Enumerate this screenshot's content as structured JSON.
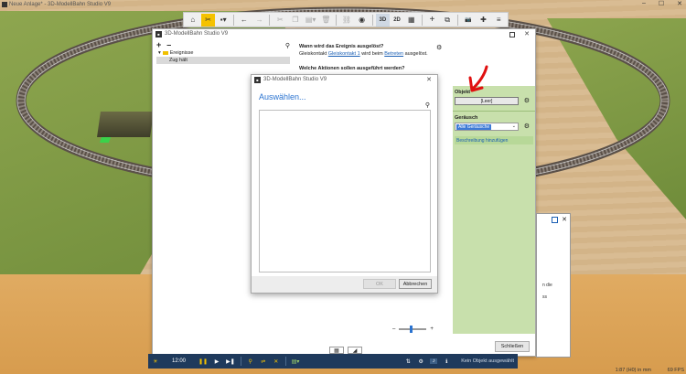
{
  "app": {
    "title": "Neue Anlage* - 3D-ModellBahn Studio V9",
    "window_controls": [
      "–",
      "☐",
      "✕"
    ]
  },
  "toolbar": {
    "buttons": [
      {
        "name": "home-icon",
        "glyph": "⌂",
        "state": "normal"
      },
      {
        "name": "tools-icon",
        "glyph": "✂",
        "state": "active"
      },
      {
        "name": "save-icon",
        "glyph": "▪▾",
        "state": "normal"
      },
      {
        "name": "undo-icon",
        "glyph": "←",
        "state": "normal"
      },
      {
        "name": "redo-icon",
        "glyph": "→",
        "state": "dim"
      },
      {
        "name": "cut-icon",
        "glyph": "✂",
        "state": "dim"
      },
      {
        "name": "copy-icon",
        "glyph": "❐",
        "state": "dim"
      },
      {
        "name": "paste-icon",
        "glyph": "▤▾",
        "state": "dim"
      },
      {
        "name": "delete-icon",
        "glyph": "🗑",
        "state": "dim"
      },
      {
        "name": "link-icon",
        "glyph": "⛓",
        "state": "dim"
      },
      {
        "name": "eye-icon",
        "glyph": "◉",
        "state": "normal"
      }
    ],
    "view_3d": "3D",
    "view_2d": "2D",
    "extra": [
      {
        "name": "grid-icon",
        "glyph": "▦"
      },
      {
        "name": "add-icon",
        "glyph": "+"
      },
      {
        "name": "duplicate-icon",
        "glyph": "⧉"
      },
      {
        "name": "camera-icon",
        "glyph": "📷"
      },
      {
        "name": "puzzle-icon",
        "glyph": "✚"
      },
      {
        "name": "menu-icon",
        "glyph": "≡"
      }
    ]
  },
  "event_window": {
    "title": "3D-ModellBahn Studio V9",
    "tree": {
      "add": "+",
      "remove": "–",
      "root": "Ereignisse",
      "selected_item": "Zug hält"
    },
    "question1": "Wann wird das Ereignis ausgelöst?",
    "trigger_prefix": "Gleiskontakt",
    "trigger_link": "Gleiskontakt 1",
    "trigger_mid": "wird beim",
    "trigger_link2": "Betreten",
    "trigger_suffix": "ausgelöst.",
    "question2": "Welche Aktionen sollen ausgeführt werden?",
    "props": {
      "object_label": "Objekt",
      "object_value": "[Leer]",
      "sound_label": "Geräusch",
      "sound_value": "Alle Geräusche",
      "add_description": "Beschreibung hinzufügen"
    },
    "zoom_minus": "–",
    "zoom_plus": "+",
    "zoom_level": 0.45,
    "close_label": "Schließen"
  },
  "select_window": {
    "title": "3D-ModellBahn Studio V9",
    "heading": "Auswählen...",
    "ok": "OK",
    "cancel": "Abbrechen"
  },
  "side_panel": {
    "text1": "n die",
    "text2": "ss"
  },
  "bottombar": {
    "time": "12:00",
    "status": "Kein Objekt ausgewählt"
  },
  "statusbar": {
    "scale": "1:87 (H0) in mm",
    "fps": "69 FPS"
  },
  "colors": {
    "accent": "#f5c200",
    "link": "#1a5fb4",
    "props_bg": "#c8e0ac",
    "bottombar": "#1f3a5c",
    "arrow": "#e01010"
  }
}
